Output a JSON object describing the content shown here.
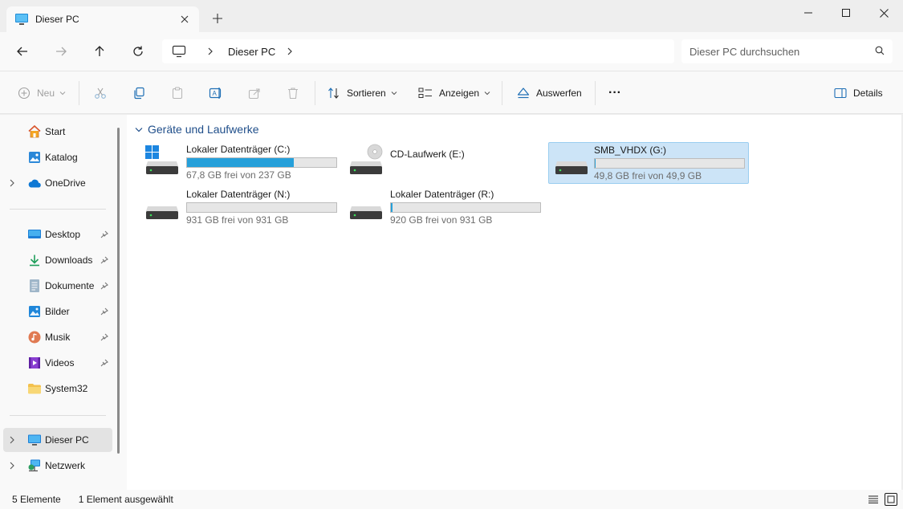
{
  "window": {
    "tab_title": "Dieser PC",
    "new_tab_label": "+"
  },
  "nav": {
    "breadcrumb": [
      "Dieser PC"
    ],
    "search_placeholder": "Dieser PC durchsuchen"
  },
  "toolbar": {
    "new_label": "Neu",
    "sort_label": "Sortieren",
    "view_label": "Anzeigen",
    "eject_label": "Auswerfen",
    "more_label": "···",
    "details_label": "Details"
  },
  "sidebar": {
    "items": [
      {
        "label": "Start",
        "icon": "home-icon"
      },
      {
        "label": "Katalog",
        "icon": "gallery-icon"
      },
      {
        "label": "OneDrive",
        "icon": "cloud-icon"
      },
      {
        "label": "Desktop",
        "icon": "desktop-icon"
      },
      {
        "label": "Downloads",
        "icon": "download-icon"
      },
      {
        "label": "Dokumente",
        "icon": "document-icon"
      },
      {
        "label": "Bilder",
        "icon": "pictures-icon"
      },
      {
        "label": "Musik",
        "icon": "music-icon"
      },
      {
        "label": "Videos",
        "icon": "videos-icon"
      },
      {
        "label": "System32",
        "icon": "folder-icon"
      },
      {
        "label": "Dieser PC",
        "icon": "pc-icon"
      },
      {
        "label": "Netzwerk",
        "icon": "network-icon"
      }
    ]
  },
  "content": {
    "group_title": "Geräte und Laufwerke",
    "drives": [
      {
        "name": "Lokaler Datenträger (C:)",
        "free": "67,8 GB frei von 237 GB",
        "used_fraction": 0.714,
        "type": "system"
      },
      {
        "name": "CD-Laufwerk (E:)",
        "free": "",
        "used_fraction": null,
        "type": "cd"
      },
      {
        "name": "SMB_VHDX (G:)",
        "free": "49,8 GB frei von 49,9 GB",
        "used_fraction": 0.002,
        "type": "disk",
        "selected": true
      },
      {
        "name": "Lokaler Datenträger (N:)",
        "free": "931 GB frei von 931 GB",
        "used_fraction": 0.0,
        "type": "disk"
      },
      {
        "name": "Lokaler Datenträger (R:)",
        "free": "920 GB frei von 931 GB",
        "used_fraction": 0.012,
        "type": "disk"
      }
    ]
  },
  "status": {
    "count": "5 Elemente",
    "selection": "1 Element ausgewählt"
  },
  "colors": {
    "accent": "#26a0da",
    "selection": "#cce4f7",
    "header_text": "#1f4e8a"
  }
}
